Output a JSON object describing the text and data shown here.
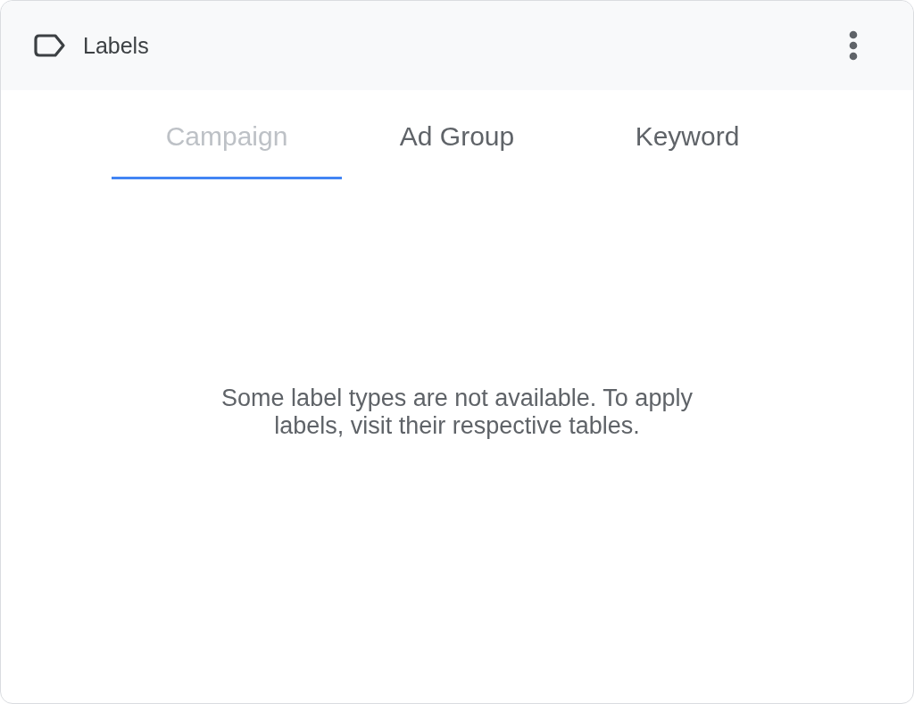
{
  "header": {
    "title": "Labels"
  },
  "tabs": [
    {
      "label": "Campaign",
      "selected": true,
      "disabled": true
    },
    {
      "label": "Ad Group",
      "selected": false,
      "disabled": false
    },
    {
      "label": "Keyword",
      "selected": false,
      "disabled": false
    }
  ],
  "message": "Some label types are not available. To apply labels, visit their respective tables."
}
